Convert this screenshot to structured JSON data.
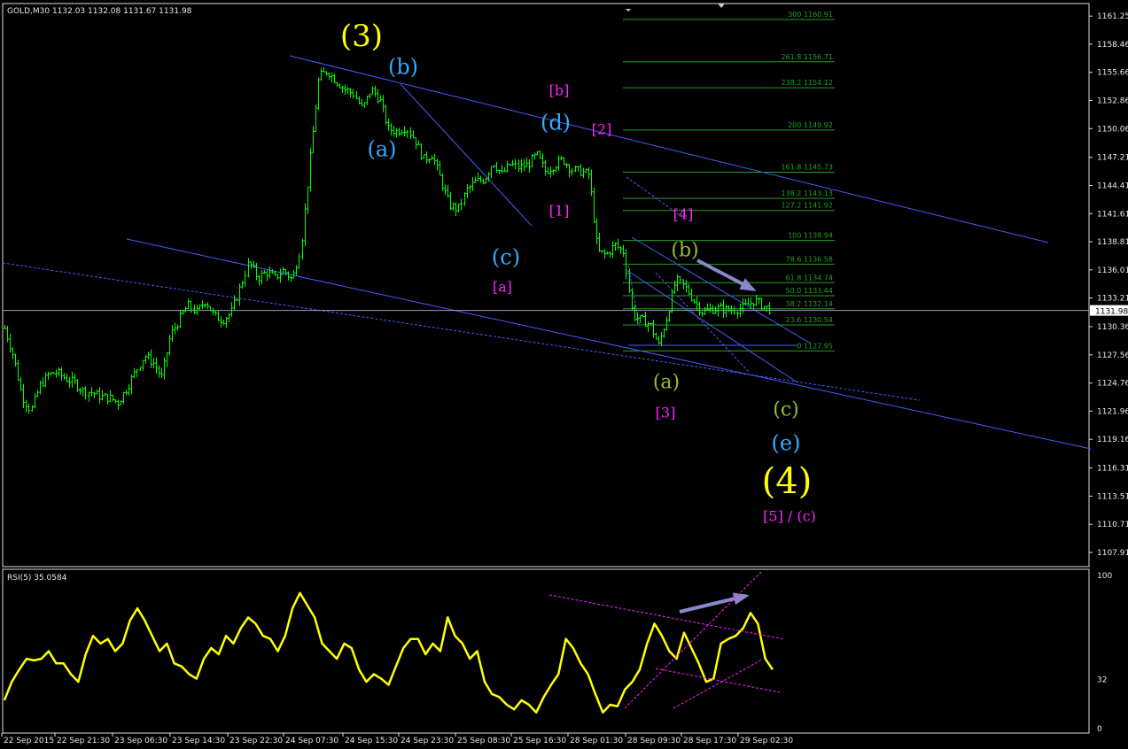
{
  "chart_data": [
    {
      "type": "candlestick",
      "title": "GOLD,M30  1132.03 1132.08 1131.67 1131.98",
      "symbol": "GOLD",
      "timeframe": "M30",
      "ohlc_last": {
        "open": 1132.03,
        "high": 1132.08,
        "low": 1131.67,
        "close": 1131.98
      },
      "current_price_label": "1131.98",
      "ylim": [
        1106.5,
        1162.5
      ],
      "y_ticks": [
        "1161.25",
        "1158.46",
        "1155.66",
        "1152.86",
        "1150.06",
        "1147.21",
        "1144.41",
        "1141.61",
        "1138.81",
        "1136.01",
        "1133.21",
        "1130.36",
        "1127.56",
        "1124.76",
        "1121.96",
        "1119.16",
        "1116.31",
        "1113.51",
        "1110.71",
        "1107.91"
      ],
      "x_tick_labels": [
        "22 Sep 2015",
        "22 Sep 21:30",
        "23 Sep 06:30",
        "23 Sep 14:30",
        "23 Sep 22:30",
        "24 Sep 07:30",
        "24 Sep 15:30",
        "24 Sep 23:30",
        "25 Sep 08:30",
        "25 Sep 16:30",
        "28 Sep 01:30",
        "28 Sep 09:30",
        "28 Sep 17:30",
        "29 Sep 02:30"
      ],
      "bar_color": "#00ff00",
      "price_path": [
        1130.2,
        1127.5,
        1123.5,
        1122.0,
        1124.5,
        1125.6,
        1125.8,
        1125.2,
        1124.8,
        1124.0,
        1123.8,
        1123.4,
        1123.3,
        1122.8,
        1124.2,
        1125.9,
        1127.5,
        1126.8,
        1125.3,
        1129.5,
        1131.0,
        1132.5,
        1131.8,
        1133.0,
        1131.4,
        1131.0,
        1131.8,
        1134.2,
        1136.8,
        1135.2,
        1135.8,
        1135.2,
        1136.0,
        1135.0,
        1138.5,
        1147.0,
        1155.2,
        1155.8,
        1154.8,
        1154.0,
        1153.5,
        1152.0,
        1154.0,
        1153.0,
        1150.0,
        1149.8,
        1150.2,
        1149.0,
        1147.0,
        1147.5,
        1145.0,
        1142.5,
        1142.0,
        1144.0,
        1144.8,
        1145.0,
        1146.8,
        1145.5,
        1146.5,
        1146.2,
        1146.5,
        1147.5,
        1145.8,
        1146.4,
        1147.0,
        1146.0,
        1145.8,
        1145.5,
        1137.8,
        1137.5,
        1138.5,
        1137.8,
        1131.5,
        1131.0,
        1130.6,
        1128.5,
        1131.4,
        1135.0,
        1134.3,
        1133.0,
        1131.8,
        1132.1,
        1132.2,
        1132.0,
        1132.1,
        1132.4,
        1133.0,
        1132.4,
        1131.98
      ],
      "fibonacci": {
        "levels": [
          {
            "ratio": "300",
            "price": 1160.91
          },
          {
            "ratio": "261.8",
            "price": 1156.71
          },
          {
            "ratio": "238.2",
            "price": 1154.12
          },
          {
            "ratio": "200",
            "price": 1149.92
          },
          {
            "ratio": "161.8",
            "price": 1145.73
          },
          {
            "ratio": "138.2",
            "price": 1143.13
          },
          {
            "ratio": "127.2",
            "price": 1141.92
          },
          {
            "ratio": "100",
            "price": 1138.94
          },
          {
            "ratio": "78.6",
            "price": 1136.58
          },
          {
            "ratio": "61.8",
            "price": 1134.74
          },
          {
            "ratio": "50.0",
            "price": 1133.44
          },
          {
            "ratio": "38.2",
            "price": 1132.14
          },
          {
            "ratio": "23.6",
            "price": 1130.54
          },
          {
            "ratio": "0",
            "price": 1127.95
          }
        ],
        "color": "#22a022"
      },
      "wave_labels": [
        {
          "text": "(3)",
          "color": "#ffff00"
        },
        {
          "text": "(b)",
          "color": "#33aaff"
        },
        {
          "text": "(a)",
          "color": "#33aaff"
        },
        {
          "text": "[b]",
          "color": "#ff22ff"
        },
        {
          "text": "(d)",
          "color": "#33aaff"
        },
        {
          "text": "[2]",
          "color": "#ff22ff"
        },
        {
          "text": "[1]",
          "color": "#ff22ff"
        },
        {
          "text": "(c)",
          "color": "#33aaff"
        },
        {
          "text": "[a]",
          "color": "#ff22ff"
        },
        {
          "text": "[4]",
          "color": "#ff22ff"
        },
        {
          "text": "(b)",
          "color": "#99bb33"
        },
        {
          "text": "(a)",
          "color": "#99bb33"
        },
        {
          "text": "[3]",
          "color": "#ff22ff"
        },
        {
          "text": "(c)",
          "color": "#99bb33"
        },
        {
          "text": "(e)",
          "color": "#33aaff"
        },
        {
          "text": "(4)",
          "color": "#ffff00"
        },
        {
          "text": "[5] / (c)",
          "color": "#ff22ff"
        }
      ],
      "trendline_color": "#4a5aff",
      "arrow_color": "#8888cc"
    },
    {
      "type": "line",
      "title": "RSI(5) 35.0584",
      "indicator": "RSI",
      "period": 5,
      "last_value": 35.0584,
      "ylim": [
        0,
        100
      ],
      "y_ticks": [
        "100",
        "32",
        "0"
      ],
      "color": "#ffff00",
      "trendline_color": "#ff22ff",
      "values": [
        18,
        30,
        38,
        45,
        44,
        45,
        50,
        42,
        42,
        35,
        30,
        48,
        60,
        55,
        58,
        50,
        55,
        70,
        78,
        70,
        60,
        50,
        55,
        42,
        40,
        35,
        32,
        45,
        52,
        48,
        60,
        55,
        65,
        72,
        68,
        60,
        58,
        50,
        60,
        78,
        88,
        80,
        72,
        55,
        50,
        45,
        55,
        52,
        38,
        30,
        35,
        32,
        28,
        40,
        52,
        58,
        58,
        48,
        55,
        50,
        72,
        60,
        55,
        45,
        50,
        30,
        22,
        20,
        15,
        12,
        18,
        15,
        10,
        20,
        28,
        35,
        58,
        52,
        42,
        35,
        22,
        10,
        15,
        14,
        25,
        30,
        38,
        55,
        68,
        60,
        50,
        45,
        62,
        52,
        42,
        30,
        32,
        55,
        58,
        60,
        65,
        75,
        68,
        45,
        38
      ]
    }
  ]
}
